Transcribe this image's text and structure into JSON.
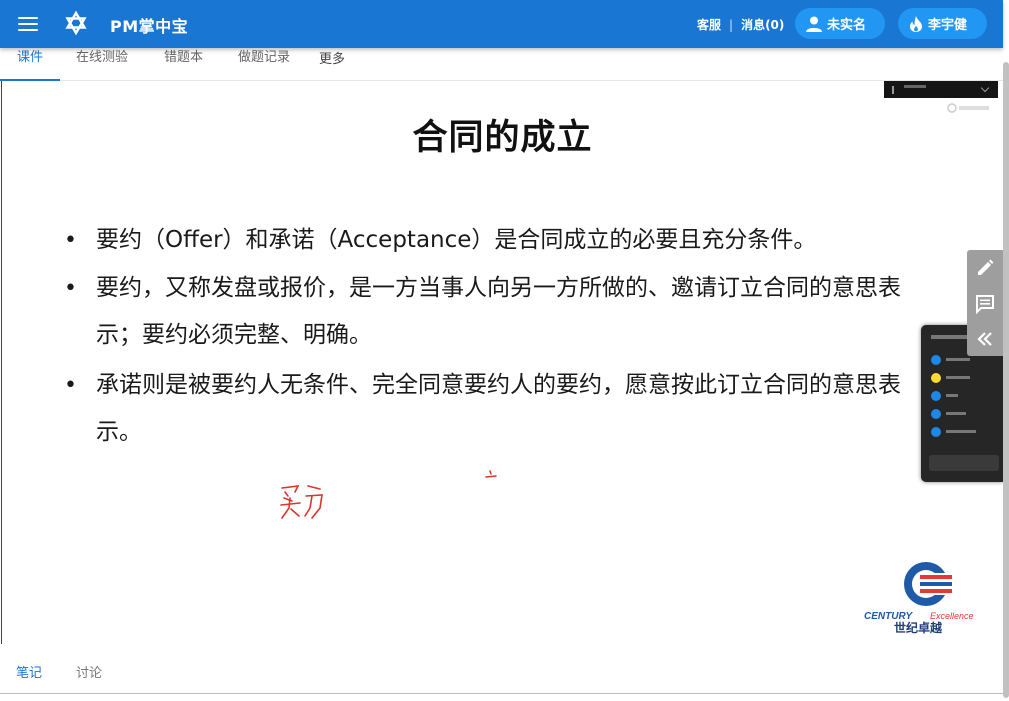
{
  "app": {
    "title": "PM掌中宝",
    "links": {
      "service": "客服",
      "separator": "|",
      "messages": "消息(0)"
    },
    "user_badge": "未实名",
    "user_name": "李宇健",
    "colors": {
      "primary": "#1976d2",
      "pill": "#2196f3"
    }
  },
  "tabs": [
    {
      "label": "课件",
      "active": true
    },
    {
      "label": "在线测验",
      "active": false
    },
    {
      "label": "错题本",
      "active": false
    },
    {
      "label": "做题记录",
      "active": false
    },
    {
      "label": "更多",
      "active": false
    }
  ],
  "slide": {
    "title": "合同的成立",
    "bullets": [
      "要约（Offer）和承诺（Acceptance）是合同成立的必要且充分条件。",
      "要约，又称发盘或报价，是一方当事人向另一方所做的、邀请订立合同的意思表示；要约必须完整、明确。",
      "承诺则是被要约人无条件、完全同意要约人的要约，愿意按此订立合同的意思表示。"
    ],
    "handwriting": "买方",
    "logo": {
      "brand": "CENTURY",
      "suffix": "Excellence",
      "cn": "世纪卓越"
    }
  },
  "side_tools": [
    {
      "icon": "pencil-icon"
    },
    {
      "icon": "comment-icon"
    },
    {
      "icon": "double-chevron-left-icon"
    }
  ],
  "bottom_tabs": [
    {
      "label": "笔记",
      "active": true
    },
    {
      "label": "讨论",
      "active": false
    }
  ]
}
